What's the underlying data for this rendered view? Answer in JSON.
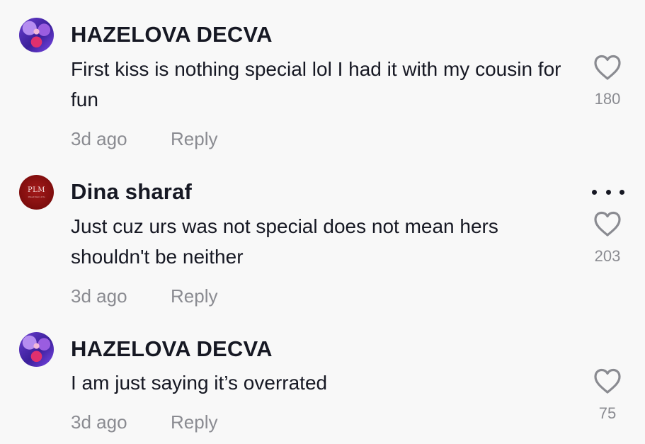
{
  "comments": [
    {
      "username": "HAZELOVA DECVA",
      "text": "First kiss is nothing special lol I had it with my cousin for fun",
      "time": "3d ago",
      "reply_label": "Reply",
      "likes": "180",
      "avatar": "purple-anime-avatar"
    },
    {
      "username": "Dina sharaf",
      "text": "Just cuz urs was not special does not mean hers shouldn't be neither",
      "time": "3d ago",
      "reply_label": "Reply",
      "likes": "203",
      "avatar_text": "PLM",
      "avatar_sub": "Palestinian Arts",
      "avatar_color": "#8b1212"
    },
    {
      "username": "HAZELOVA DECVA",
      "text": "I am just saying it’s overrated",
      "time": "3d ago",
      "reply_label": "Reply",
      "likes": "75",
      "avatar": "purple-anime-avatar"
    }
  ],
  "icons": {
    "like": "heart-outline-icon",
    "more": "more-options-icon"
  }
}
